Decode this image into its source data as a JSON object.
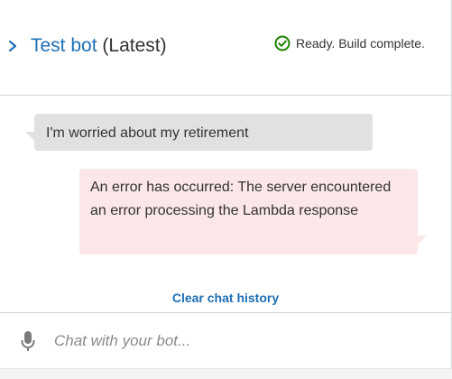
{
  "header": {
    "bot_name": "Test bot",
    "version": "(Latest)",
    "status_text": "Ready. Build complete.",
    "status_icon": "check-circle-icon",
    "status_color": "#1d8102",
    "link_color": "#1f6fb5"
  },
  "messages": [
    {
      "sender": "user",
      "text": "I'm worried about my retirement"
    },
    {
      "sender": "bot",
      "text": "An error has occurred: The server encountered an error processing the Lambda response",
      "type": "error"
    }
  ],
  "actions": {
    "clear_label": "Clear chat history"
  },
  "input": {
    "placeholder": "Chat with your bot...",
    "value": "",
    "mic_icon": "microphone-icon"
  }
}
